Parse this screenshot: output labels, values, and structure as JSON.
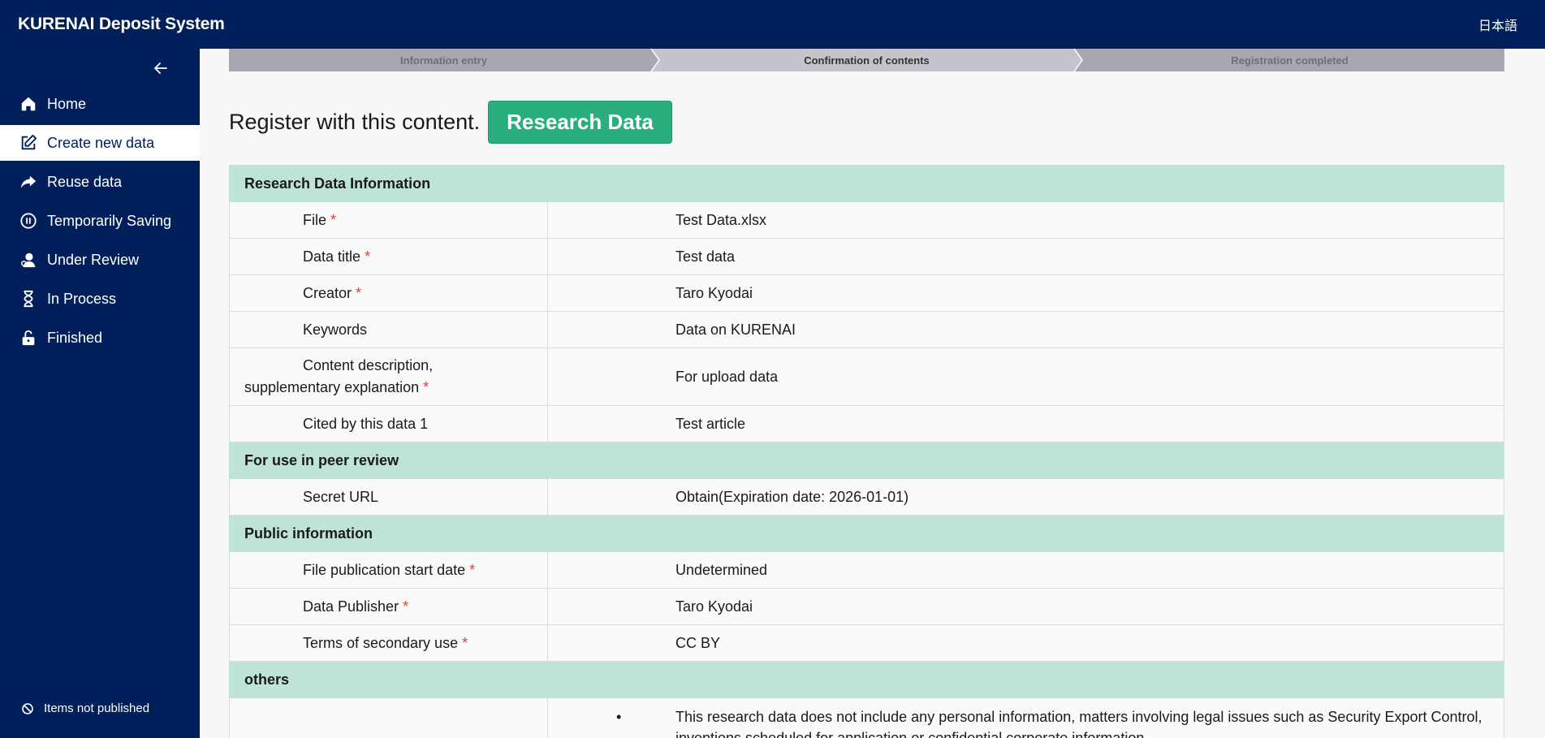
{
  "header": {
    "app_title": "KURENAI Deposit System",
    "language_link": "日本語"
  },
  "sidebar": {
    "items": [
      {
        "label": "Home",
        "icon": "home-icon"
      },
      {
        "label": "Create new data",
        "icon": "edit-icon"
      },
      {
        "label": "Reuse data",
        "icon": "share-arrow-icon"
      },
      {
        "label": "Temporarily Saving",
        "icon": "pause-circle-icon"
      },
      {
        "label": "Under Review",
        "icon": "reviewer-icon"
      },
      {
        "label": "In Process",
        "icon": "hourglass-icon"
      },
      {
        "label": "Finished",
        "icon": "unlock-icon"
      }
    ],
    "active_index": 1,
    "footer_label": "Items not published"
  },
  "stepper": {
    "steps": [
      "Information entry",
      "Confirmation of contents",
      "Registration completed"
    ],
    "current": 1
  },
  "main": {
    "heading": "Register with this content.",
    "badge": "Research Data"
  },
  "sections": [
    {
      "title": "Research Data Information",
      "rows": [
        {
          "label": "File",
          "required": "*",
          "value": "Test Data.xlsx"
        },
        {
          "label": "Data title",
          "required": "*",
          "value": "Test data"
        },
        {
          "label": "Creator",
          "required": "*",
          "value": "Taro Kyodai"
        },
        {
          "label": "Keywords",
          "required": "",
          "value": "Data on KURENAI"
        },
        {
          "label": "Content description, supplementary explanation",
          "required": "*",
          "value": "For upload data"
        },
        {
          "label": "Cited by this data 1",
          "required": "",
          "value": "Test article"
        }
      ]
    },
    {
      "title": "For use in peer review",
      "rows": [
        {
          "label": "Secret URL",
          "required": "",
          "value": "Obtain(Expiration date: 2026-01-01)"
        }
      ]
    },
    {
      "title": "Public information",
      "rows": [
        {
          "label": "File publication start date",
          "required": "*",
          "value": "Undetermined"
        },
        {
          "label": "Data Publisher",
          "required": "*",
          "value": "Taro Kyodai"
        },
        {
          "label": "Terms of secondary use",
          "required": "*",
          "value": "CC BY"
        }
      ]
    },
    {
      "title": "others",
      "bullet": "This research data does not include any personal information, matters involving legal issues such as Security Export Control, inventions scheduled for application or confidential corporate information."
    }
  ]
}
